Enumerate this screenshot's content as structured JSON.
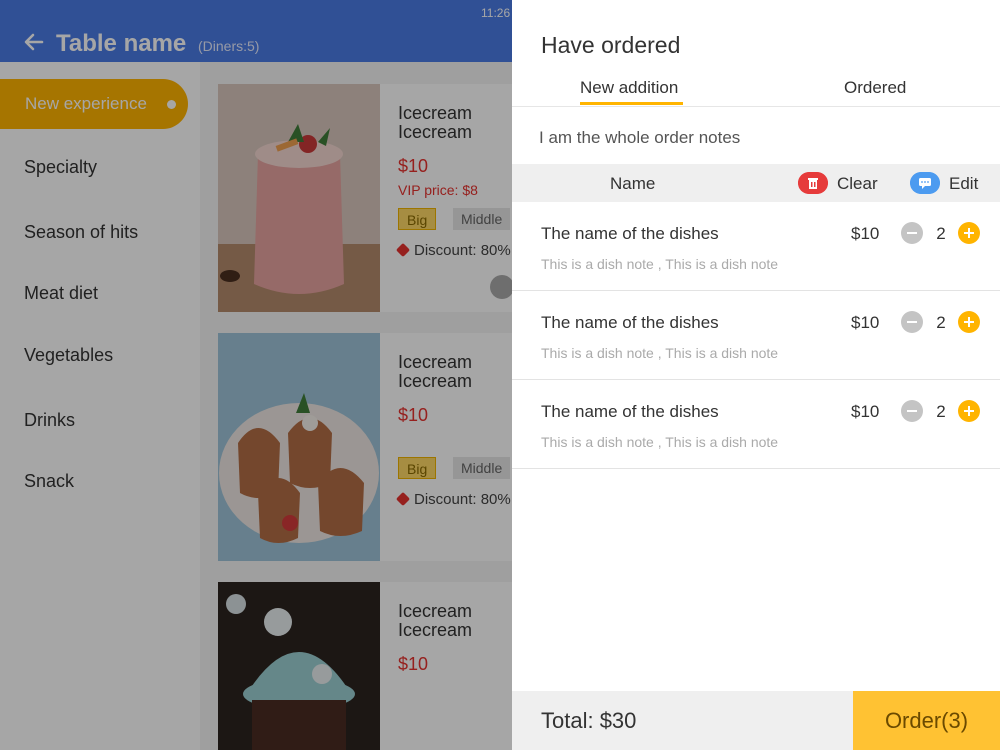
{
  "status_bar": {
    "time": "11:26"
  },
  "header": {
    "title": "Table name",
    "diners": "(Diners:5)"
  },
  "sidebar": {
    "items": [
      {
        "label": "New experience",
        "active": true
      },
      {
        "label": "Specialty"
      },
      {
        "label": "Season of hits"
      },
      {
        "label": "Meat diet"
      },
      {
        "label": "Vegetables"
      },
      {
        "label": "Drinks"
      },
      {
        "label": "Snack"
      }
    ]
  },
  "products": [
    {
      "title": "Icecream Icecream",
      "price": "$10",
      "vip_price": "VIP price: $8",
      "tags": [
        "Big",
        "Middle"
      ],
      "discount": "Discount: 80%"
    },
    {
      "title": "Icecream Icecream",
      "price": "$10",
      "tags": [
        "Big",
        "Middle"
      ],
      "discount": "Discount: 80%"
    },
    {
      "title": "Icecream Icecream",
      "price": "$10"
    }
  ],
  "panel": {
    "title": "Have ordered",
    "tabs": [
      {
        "label": "New addition",
        "active": true
      },
      {
        "label": "Ordered"
      }
    ],
    "order_notes": "I am the whole order notes",
    "header": {
      "name_label": "Name",
      "clear_label": "Clear",
      "edit_label": "Edit"
    },
    "dishes": [
      {
        "name": "The name of the dishes",
        "price": "$10",
        "qty": "2",
        "note": "This is a dish note , This is a dish note"
      },
      {
        "name": "The name of the dishes",
        "price": "$10",
        "qty": "2",
        "note": "This is a dish note , This is a dish note"
      },
      {
        "name": "The name of the dishes",
        "price": "$10",
        "qty": "2",
        "note": "This is a dish note , This is a dish note"
      }
    ],
    "total": "Total: $30",
    "order_button": "Order(3)"
  },
  "colors": {
    "accent": "#ffb400",
    "header_blue": "#4a7be5",
    "price_red": "#e6322e",
    "order_button": "#ffc233"
  }
}
